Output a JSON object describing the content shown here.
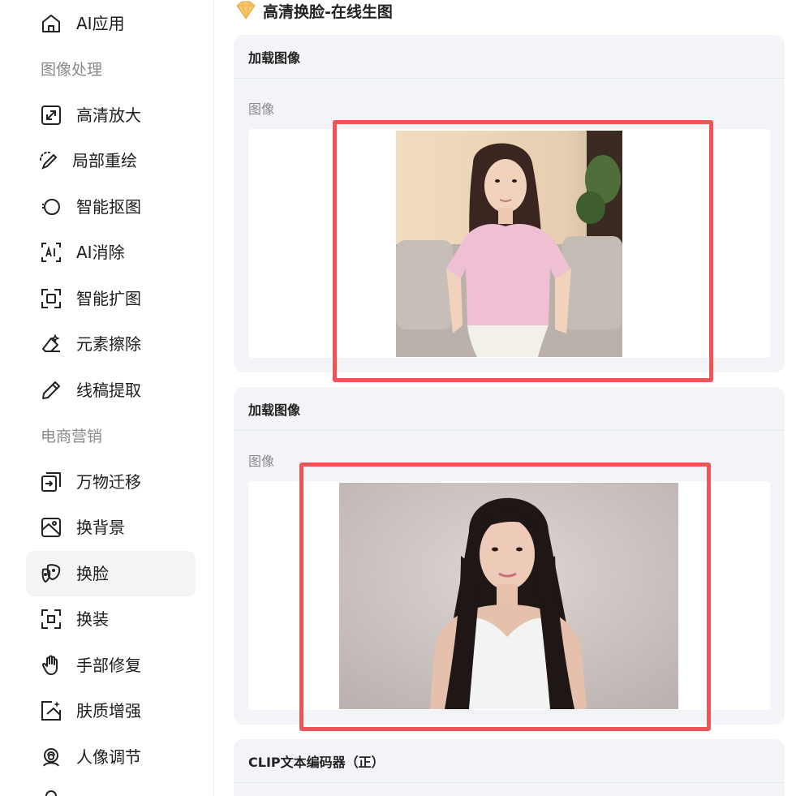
{
  "sidebar": {
    "items": [
      {
        "label": "AI应用",
        "icon": "home-icon"
      },
      {
        "label": "高清放大",
        "icon": "upscale-icon"
      },
      {
        "label": "局部重绘",
        "icon": "brush-icon"
      },
      {
        "label": "智能抠图",
        "icon": "cutout-icon"
      },
      {
        "label": "AI消除",
        "icon": "ai-erase-icon"
      },
      {
        "label": "智能扩图",
        "icon": "expand-icon"
      },
      {
        "label": "元素擦除",
        "icon": "eraser-icon"
      },
      {
        "label": "线稿提取",
        "icon": "pencil-icon"
      },
      {
        "label": "万物迁移",
        "icon": "transfer-icon"
      },
      {
        "label": "换背景",
        "icon": "background-icon"
      },
      {
        "label": "换脸",
        "icon": "mask-icon"
      },
      {
        "label": "换装",
        "icon": "outfit-icon"
      },
      {
        "label": "手部修复",
        "icon": "hand-icon"
      },
      {
        "label": "肤质增强",
        "icon": "sparkle-icon"
      },
      {
        "label": "人像调节",
        "icon": "portrait-icon"
      }
    ],
    "sections": [
      "图像处理",
      "电商营销"
    ],
    "active_item": "换脸"
  },
  "main": {
    "title": "高清换脸-在线生图",
    "cards": [
      {
        "header": "加载图像",
        "field_label": "图像"
      },
      {
        "header": "加载图像",
        "field_label": "图像"
      },
      {
        "header": "CLIP文本编码器（正）"
      }
    ]
  },
  "colors": {
    "highlight": "#ee5556",
    "card_bg": "#f2f4f8",
    "active_bg": "#f4f4f5"
  }
}
